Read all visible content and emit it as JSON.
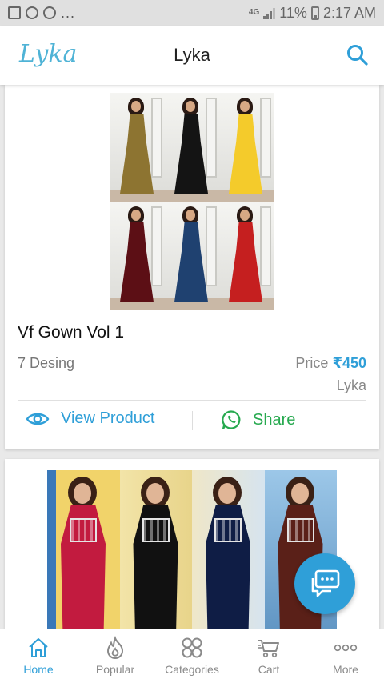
{
  "status_bar": {
    "dots": "...",
    "network": "4G",
    "battery_percent": "11%",
    "time": "2:17 AM"
  },
  "app_bar": {
    "logo_text": "Lyka",
    "title": "Lyka",
    "search_icon": "search-icon"
  },
  "products": [
    {
      "title": "Vf Gown Vol 1",
      "designs": "7 Desing",
      "price_label": "Price",
      "price": "₹450",
      "brand": "Lyka",
      "view_label": "View Product",
      "share_label": "Share",
      "swatch_colors": [
        "#8d7431",
        "#141414",
        "#f4cb2b",
        "#5c0f15",
        "#1f4170",
        "#c51f1f"
      ]
    },
    {
      "swatch_colors": [
        "#c21b3f",
        "#111111",
        "#0f1d45",
        "#5a2018"
      ]
    }
  ],
  "bottom_nav": [
    {
      "label": "Home",
      "icon": "home-icon",
      "active": true
    },
    {
      "label": "Popular",
      "icon": "flame-icon",
      "active": false
    },
    {
      "label": "Categories",
      "icon": "grid-icon",
      "active": false
    },
    {
      "label": "Cart",
      "icon": "cart-icon",
      "active": false
    },
    {
      "label": "More",
      "icon": "more-icon",
      "active": false
    }
  ],
  "fab_icon": "chat-icon",
  "colors": {
    "accent": "#2f9fd8",
    "share_green": "#27a94f",
    "logo": "#4fb3d6"
  }
}
